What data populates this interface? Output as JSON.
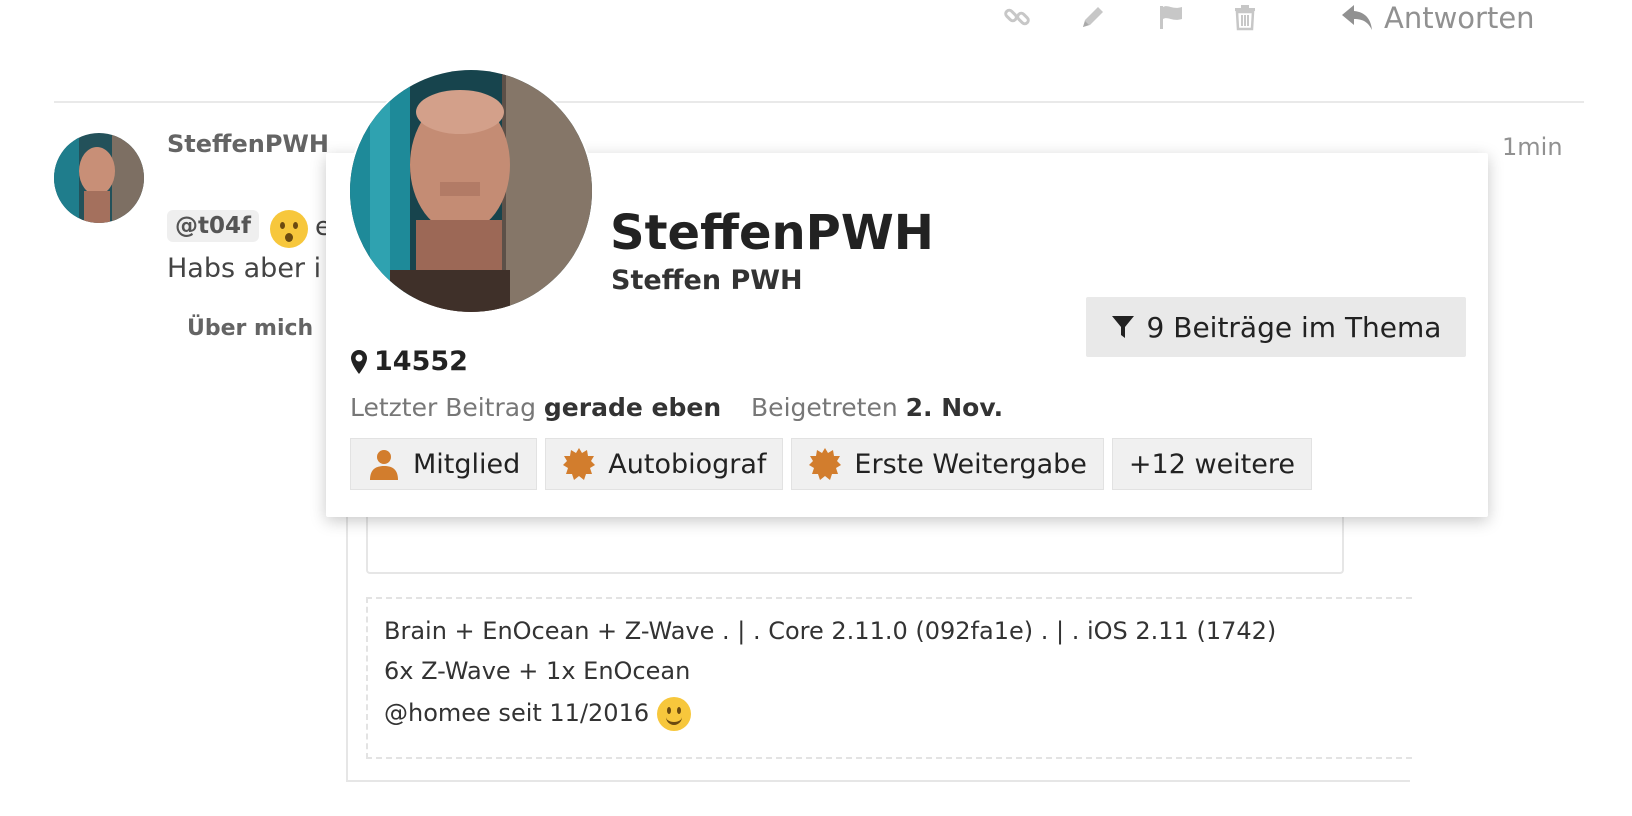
{
  "toolbar": {
    "icons": [
      "link-icon",
      "pencil-icon",
      "flag-icon",
      "trash-icon"
    ],
    "reply_label": "Antworten"
  },
  "post": {
    "username": "SteffenPWH",
    "time": "1min",
    "mention": "@t04f",
    "fragment_after_emoji": "e",
    "line2": "Habs aber i",
    "about_link": "Über mich"
  },
  "signature": {
    "line1": "Brain + EnOcean + Z-Wave . | . Core 2.11.0 (092fa1e) . | . iOS 2.11 (1742)",
    "line2": "6x Z-Wave + 1x EnOcean",
    "line3": "@homee seit 11/2016"
  },
  "profile_card": {
    "username": "SteffenPWH",
    "full_name": "Steffen PWH",
    "topic_posts_button": "9 Beiträge im Thema",
    "location": "14552",
    "last_post_label": "Letzter Beitrag",
    "last_post_value": "gerade eben",
    "joined_label": "Beigetreten",
    "joined_value": "2. Nov.",
    "badges": [
      {
        "label": "Mitglied",
        "icon": "user-icon"
      },
      {
        "label": "Autobiograf",
        "icon": "certificate-icon"
      },
      {
        "label": "Erste Weitergabe",
        "icon": "certificate-icon"
      },
      {
        "label": "+12 weitere",
        "icon": ""
      }
    ]
  },
  "colors": {
    "badge_icon": "#d27d2d",
    "muted_text": "#919191",
    "button_bg": "#e9e9e9"
  }
}
